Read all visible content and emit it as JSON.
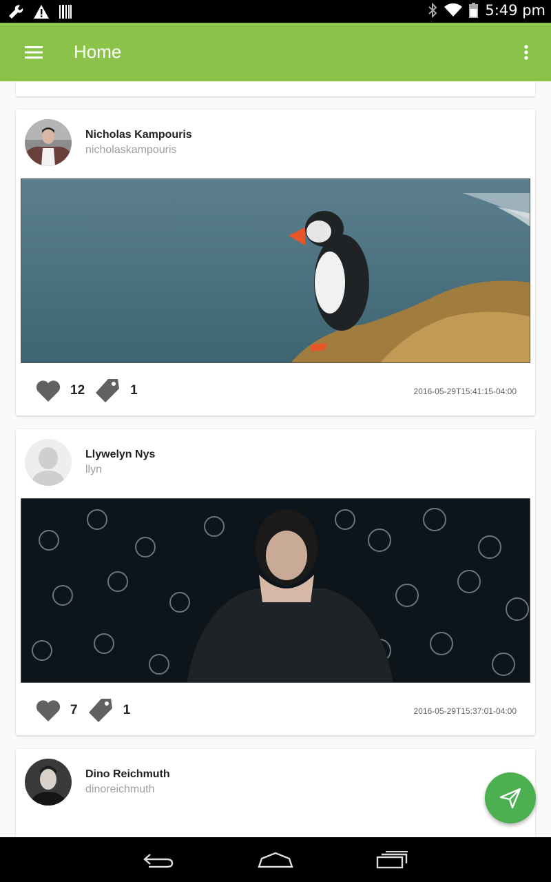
{
  "status_bar": {
    "time": "5:49 pm",
    "icons": [
      "wrench-icon",
      "warning-icon",
      "barcode-icon",
      "bluetooth-icon",
      "wifi-icon",
      "battery-icon"
    ]
  },
  "app_bar": {
    "title": "Home",
    "color": "#8bc34a",
    "menu_icon": "hamburger-menu-icon",
    "overflow_icon": "more-vert-icon"
  },
  "feed": {
    "posts": [
      {
        "author_name": "Nicholas Kampouris",
        "author_handle": "nicholaskampouris",
        "image": "puffin-on-cliff-by-sea",
        "likes": "12",
        "tags": "1",
        "timestamp": "2016-05-29T15:41:15-04:00"
      },
      {
        "author_name": "Llywelyn Nys",
        "author_handle": "llyn",
        "image": "woman-covering-face-dark-background",
        "likes": "7",
        "tags": "1",
        "timestamp": "2016-05-29T15:37:01-04:00"
      },
      {
        "author_name": "Dino Reichmuth",
        "author_handle": "dinoreichmuth"
      }
    ]
  },
  "fab": {
    "icon": "send-icon",
    "color": "#4caf50"
  },
  "nav_bar": {
    "buttons": [
      "back-icon",
      "home-icon",
      "recents-icon"
    ]
  }
}
